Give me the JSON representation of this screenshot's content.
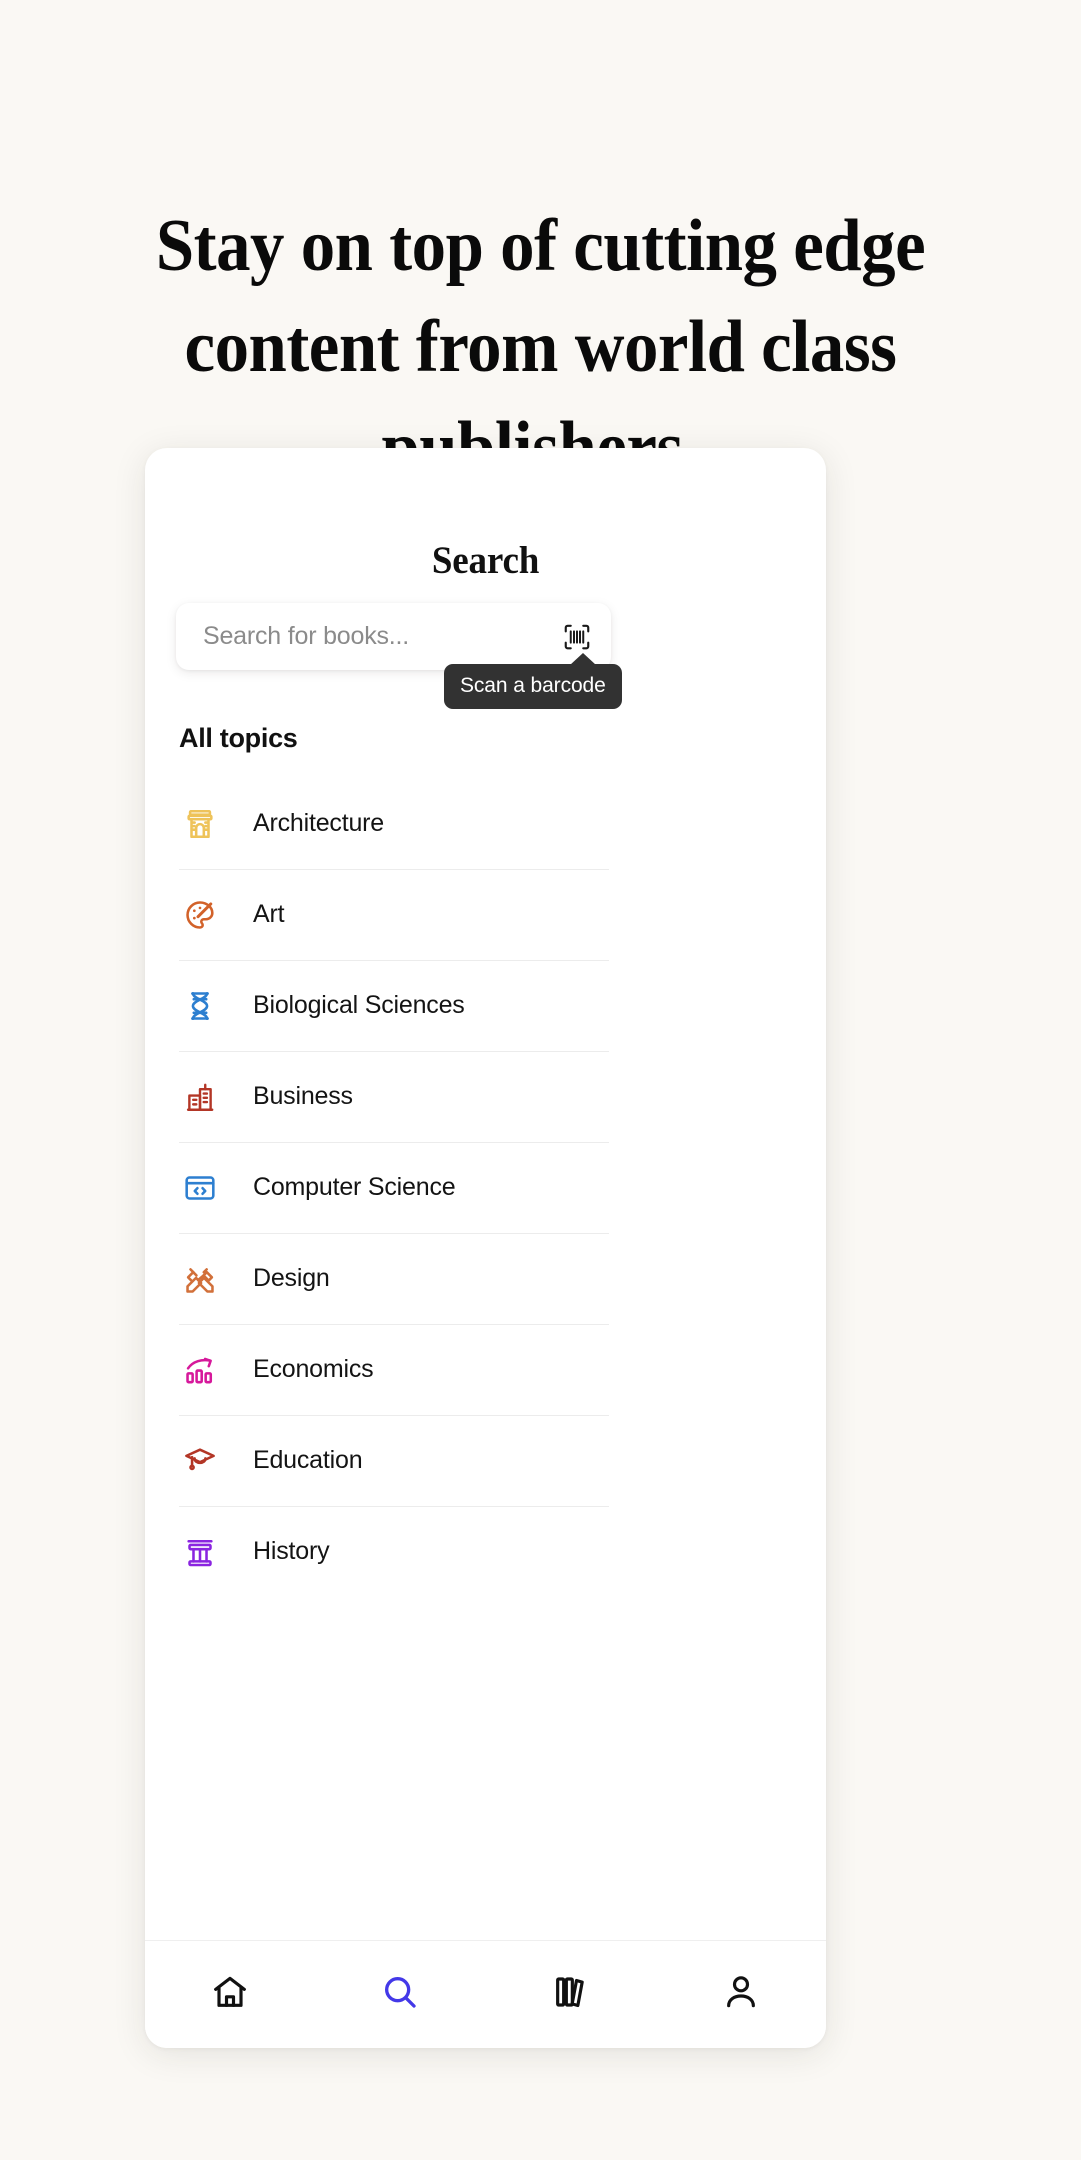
{
  "headline": "Stay on top of cutting edge content from world class publishers.",
  "card": {
    "search_title": "Search",
    "search": {
      "placeholder": "Search for books...",
      "value": "",
      "barcode_icon": "barcode-scan-icon",
      "tooltip": "Scan a barcode"
    },
    "topics_heading": "All topics",
    "topics": [
      {
        "label": "Architecture",
        "icon": "arch-monument-icon",
        "color": "#eec35a"
      },
      {
        "label": "Art",
        "icon": "paint-palette-icon",
        "color": "#d2622a"
      },
      {
        "label": "Biological Sciences",
        "icon": "dna-helix-icon",
        "color": "#2d7fd0"
      },
      {
        "label": "Business",
        "icon": "office-building-icon",
        "color": "#b33626"
      },
      {
        "label": "Computer Science",
        "icon": "code-window-icon",
        "color": "#2d7fd0"
      },
      {
        "label": "Design",
        "icon": "pencil-ruler-icon",
        "color": "#d2703a"
      },
      {
        "label": "Economics",
        "icon": "growth-chart-icon",
        "color": "#d6189b"
      },
      {
        "label": "Education",
        "icon": "graduation-cap-icon",
        "color": "#b33626"
      },
      {
        "label": "History",
        "icon": "greek-column-icon",
        "color": "#8a24e0"
      }
    ],
    "bottom_nav": [
      {
        "icon": "home-icon",
        "active": false,
        "color": "#111111"
      },
      {
        "icon": "search-icon",
        "active": true,
        "color": "#4338e8"
      },
      {
        "icon": "library-icon",
        "active": false,
        "color": "#111111"
      },
      {
        "icon": "profile-icon",
        "active": false,
        "color": "#111111"
      }
    ]
  },
  "colors": {
    "background": "#faf8f4",
    "card": "#ffffff",
    "accent": "#4338e8",
    "tooltip_bg": "#323232",
    "divider": "#ececec",
    "placeholder": "#8b8b8b"
  }
}
